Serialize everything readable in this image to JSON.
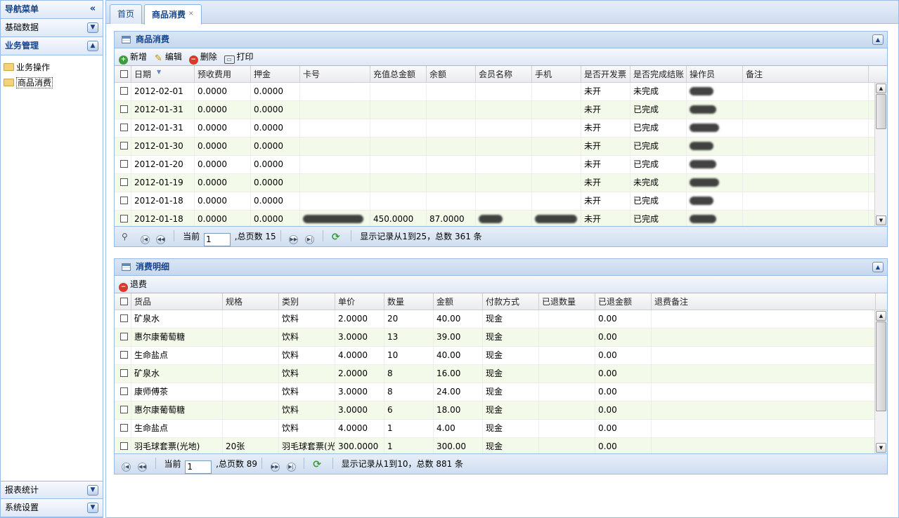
{
  "nav": {
    "title": "导航菜单",
    "collapse_glyph": "«",
    "sections_top": [
      {
        "label": "基础数据",
        "expanded": false
      },
      {
        "label": "业务管理",
        "expanded": true
      }
    ],
    "tree": [
      {
        "label": "业务操作",
        "selected": false
      },
      {
        "label": "商品消费",
        "selected": true
      }
    ],
    "sections_bottom": [
      {
        "label": "报表统计"
      },
      {
        "label": "系统设置"
      }
    ]
  },
  "tabs": [
    {
      "label": "首页",
      "active": false
    },
    {
      "label": "商品消费",
      "active": true,
      "closable": true
    }
  ],
  "consumption_panel": {
    "title": "商品消费",
    "toolbar": {
      "add": "新增",
      "edit": "编辑",
      "delete": "删除",
      "print": "打印"
    },
    "columns": [
      "日期",
      "预收费用",
      "押金",
      "卡号",
      "充值总金额",
      "余额",
      "会员名称",
      "手机",
      "是否开发票",
      "是否完成结账",
      "操作员",
      "备注"
    ],
    "rows": [
      {
        "date": "2012-02-01",
        "prepaid": "0.0000",
        "deposit": "0.0000",
        "card": "",
        "recharge": "",
        "balance": "",
        "member": "",
        "phone": "",
        "invoice": "未开",
        "settled": "未完成",
        "remark": ""
      },
      {
        "date": "2012-01-31",
        "prepaid": "0.0000",
        "deposit": "0.0000",
        "card": "",
        "recharge": "",
        "balance": "",
        "member": "",
        "phone": "",
        "invoice": "未开",
        "settled": "已完成",
        "remark": ""
      },
      {
        "date": "2012-01-31",
        "prepaid": "0.0000",
        "deposit": "0.0000",
        "card": "",
        "recharge": "",
        "balance": "",
        "member": "",
        "phone": "",
        "invoice": "未开",
        "settled": "已完成",
        "remark": ""
      },
      {
        "date": "2012-01-30",
        "prepaid": "0.0000",
        "deposit": "0.0000",
        "card": "",
        "recharge": "",
        "balance": "",
        "member": "",
        "phone": "",
        "invoice": "未开",
        "settled": "已完成",
        "remark": ""
      },
      {
        "date": "2012-01-20",
        "prepaid": "0.0000",
        "deposit": "0.0000",
        "card": "",
        "recharge": "",
        "balance": "",
        "member": "",
        "phone": "",
        "invoice": "未开",
        "settled": "已完成",
        "remark": ""
      },
      {
        "date": "2012-01-19",
        "prepaid": "0.0000",
        "deposit": "0.0000",
        "card": "",
        "recharge": "",
        "balance": "",
        "member": "",
        "phone": "",
        "invoice": "未开",
        "settled": "未完成",
        "remark": ""
      },
      {
        "date": "2012-01-18",
        "prepaid": "0.0000",
        "deposit": "0.0000",
        "card": "",
        "recharge": "",
        "balance": "",
        "member": "",
        "phone": "",
        "invoice": "未开",
        "settled": "已完成",
        "remark": ""
      },
      {
        "date": "2012-01-18",
        "prepaid": "0.0000",
        "deposit": "0.0000",
        "card": "",
        "recharge": "450.0000",
        "balance": "87.0000",
        "member": "",
        "phone": "",
        "invoice": "未开",
        "settled": "已完成",
        "remark": "",
        "redacted_card": true,
        "redacted_member": true,
        "redacted_phone": true
      }
    ],
    "pager": {
      "current_label": "当前",
      "page": "1",
      "total_pages_text": ",总页数 15",
      "summary": "显示记录从1到25，总数 361 条"
    }
  },
  "detail_panel": {
    "title": "消费明细",
    "toolbar": {
      "refund": "退费"
    },
    "columns": [
      "货品",
      "规格",
      "类别",
      "单价",
      "数量",
      "金额",
      "付款方式",
      "已退数量",
      "已退金额",
      "退费备注"
    ],
    "rows": [
      {
        "item": "矿泉水",
        "spec": "",
        "category": "饮料",
        "price": "2.0000",
        "qty": "20",
        "amount": "40.00",
        "pay": "现金",
        "ret_qty": "",
        "ret_amount": "0.00",
        "ret_note": ""
      },
      {
        "item": "惠尔康葡萄糖",
        "spec": "",
        "category": "饮料",
        "price": "3.0000",
        "qty": "13",
        "amount": "39.00",
        "pay": "现金",
        "ret_qty": "",
        "ret_amount": "0.00",
        "ret_note": ""
      },
      {
        "item": "生命盐点",
        "spec": "",
        "category": "饮料",
        "price": "4.0000",
        "qty": "10",
        "amount": "40.00",
        "pay": "现金",
        "ret_qty": "",
        "ret_amount": "0.00",
        "ret_note": ""
      },
      {
        "item": "矿泉水",
        "spec": "",
        "category": "饮料",
        "price": "2.0000",
        "qty": "8",
        "amount": "16.00",
        "pay": "现金",
        "ret_qty": "",
        "ret_amount": "0.00",
        "ret_note": ""
      },
      {
        "item": "康师傅茶",
        "spec": "",
        "category": "饮料",
        "price": "3.0000",
        "qty": "8",
        "amount": "24.00",
        "pay": "现金",
        "ret_qty": "",
        "ret_amount": "0.00",
        "ret_note": ""
      },
      {
        "item": "惠尔康葡萄糖",
        "spec": "",
        "category": "饮料",
        "price": "3.0000",
        "qty": "6",
        "amount": "18.00",
        "pay": "现金",
        "ret_qty": "",
        "ret_amount": "0.00",
        "ret_note": ""
      },
      {
        "item": "生命盐点",
        "spec": "",
        "category": "饮料",
        "price": "4.0000",
        "qty": "1",
        "amount": "4.00",
        "pay": "现金",
        "ret_qty": "",
        "ret_amount": "0.00",
        "ret_note": ""
      },
      {
        "item": "羽毛球套票(光地)",
        "spec": "20张",
        "category": "羽毛球套票(光",
        "price": "300.0000",
        "qty": "1",
        "amount": "300.00",
        "pay": "现金",
        "ret_qty": "",
        "ret_amount": "0.00",
        "ret_note": ""
      }
    ],
    "pager": {
      "current_label": "当前",
      "page": "1",
      "total_pages_text": ",总页数 89",
      "summary": "显示记录从1到10，总数 881 条"
    }
  }
}
